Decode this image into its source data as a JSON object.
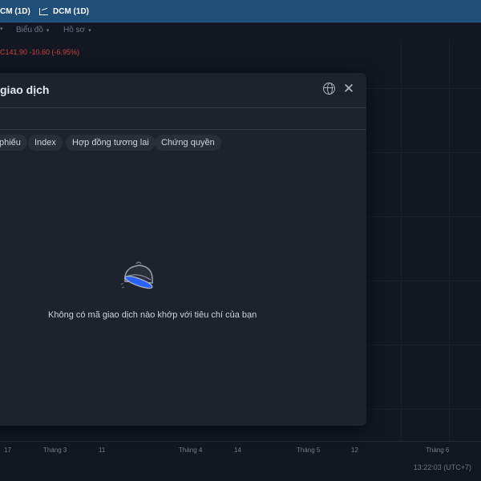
{
  "tabs": [
    {
      "label": "CM (1D)"
    },
    {
      "label": "DCM (1D)"
    }
  ],
  "toolbar": {
    "chart_label": "Biểu đồ",
    "profile_label": "Hồ sơ"
  },
  "chart": {
    "price_text": "C141.90 -10.60 (-6.95%)",
    "axis_labels": [
      "17",
      "Tháng 3",
      "11",
      "Tháng 4",
      "14",
      "Tháng 5",
      "12",
      "Tháng 6"
    ],
    "clock": "13:22:03 (UTC+7)"
  },
  "modal": {
    "title": "giao dịch",
    "close_icon": "close-icon",
    "globe_icon": "globe-icon",
    "chips": [
      "phiếu",
      "Index",
      "Hợp đồng tương lai",
      "Chứng quyền"
    ],
    "empty_message": "Không có mã giao dịch nào khớp với tiêu chí của bạn"
  },
  "colors": {
    "background": "#131722",
    "tabbar": "#1f4e79",
    "modal": "#1e222d",
    "chip": "#2a2e39",
    "negative": "#c8423c",
    "accent": "#2962ff"
  }
}
